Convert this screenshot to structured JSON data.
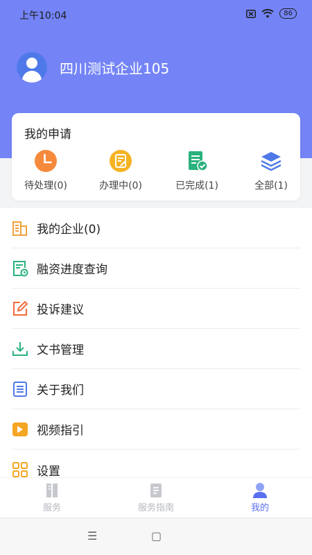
{
  "status": {
    "time": "上午10:04",
    "battery": "86"
  },
  "profile": {
    "company": "四川测试企业105"
  },
  "applications": {
    "title": "我的申请",
    "items": [
      {
        "label": "待处理(0)",
        "icon": "clock-icon",
        "color": "#f58a3d"
      },
      {
        "label": "办理中(0)",
        "icon": "edit-doc-icon",
        "color": "#f5b324"
      },
      {
        "label": "已完成(1)",
        "icon": "doc-check-icon",
        "color": "#29b27c"
      },
      {
        "label": "全部(1)",
        "icon": "layers-icon",
        "color": "#4f79e8"
      }
    ]
  },
  "menu": [
    {
      "label": "我的企业(0)",
      "icon": "building-icon"
    },
    {
      "label": "融资进度查询",
      "icon": "progress-doc-icon"
    },
    {
      "label": "投诉建议",
      "icon": "pen-edit-icon"
    },
    {
      "label": "文书管理",
      "icon": "download-icon"
    },
    {
      "label": "关于我们",
      "icon": "doc-list-icon"
    },
    {
      "label": "视频指引",
      "icon": "video-icon"
    },
    {
      "label": "设置",
      "icon": "grid-settings-icon"
    }
  ],
  "tabs": [
    {
      "label": "服务",
      "icon": "service-icon",
      "active": false
    },
    {
      "label": "服务指南",
      "icon": "guide-icon",
      "active": false
    },
    {
      "label": "我的",
      "icon": "user-icon",
      "active": true
    }
  ],
  "colors": {
    "header": "#7484f6",
    "accent": "#5b6ef2"
  }
}
